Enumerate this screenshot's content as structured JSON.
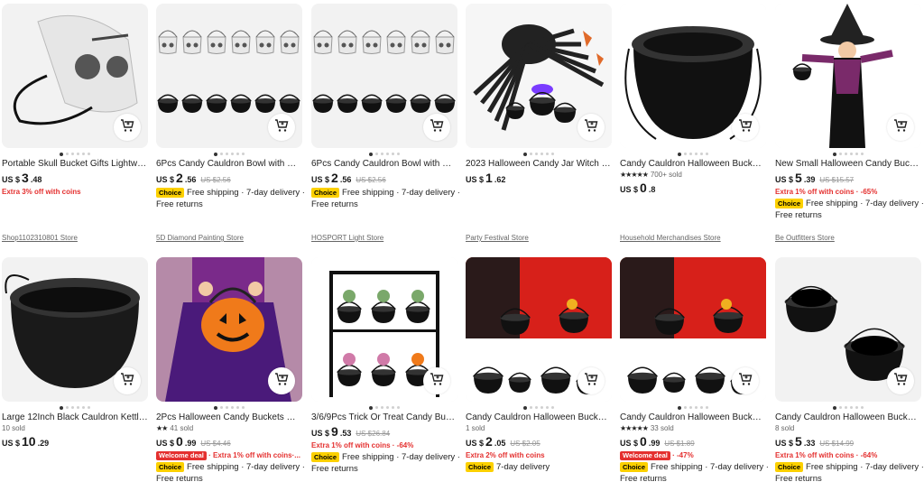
{
  "products": [
    {
      "title": "Portable Skull Bucket Gifts Lightwei...",
      "rating": "",
      "sold": "",
      "currency": "US $",
      "price_int": "3",
      "price_dec": ".48",
      "old_price": "",
      "promo": "Extra 3% off with coins",
      "deal_badge": "",
      "choice": "",
      "shipping": "",
      "returns": "",
      "store": "Shop1102310801 Store",
      "icon": "skull-bucket-image"
    },
    {
      "title": "6Pcs Candy Cauldron Bowl with Han...",
      "rating": "",
      "sold": "",
      "currency": "US $",
      "price_int": "2",
      "price_dec": ".56",
      "old_price": "US $2.56",
      "promo": "",
      "deal_badge": "",
      "choice": "Choice",
      "shipping": "Free shipping · 7-day delivery ·",
      "returns": "Free returns",
      "store": "5D Diamond Painting Store",
      "icon": "cauldron-set-image"
    },
    {
      "title": "6Pcs Candy Cauldron Bowl with Han...",
      "rating": "",
      "sold": "",
      "currency": "US $",
      "price_int": "2",
      "price_dec": ".56",
      "old_price": "US $2.56",
      "promo": "",
      "deal_badge": "",
      "choice": "Choice",
      "shipping": "Free shipping · 7-day delivery ·",
      "returns": "Free returns",
      "store": "HOSPORT Light Store",
      "icon": "cauldron-set-image"
    },
    {
      "title": "2023 Halloween Candy Jar Witch Fla...",
      "rating": "",
      "sold": "",
      "currency": "US $",
      "price_int": "1",
      "price_dec": ".62",
      "old_price": "",
      "promo": "",
      "deal_badge": "",
      "choice": "",
      "shipping": "",
      "returns": "",
      "store": "Party Festival Store",
      "icon": "spider-cauldron-image"
    },
    {
      "title": "Candy Cauldron Halloween Bucket ...",
      "rating": "★★★★★",
      "sold": "700+ sold",
      "currency": "US $",
      "price_int": "0",
      "price_dec": ".8",
      "old_price": "",
      "promo": "",
      "deal_badge": "",
      "choice": "",
      "shipping": "",
      "returns": "",
      "store": "Household Merchandises Store",
      "icon": "large-cauldron-image"
    },
    {
      "title": "New Small Halloween Candy Bucket...",
      "rating": "",
      "sold": "",
      "currency": "US $",
      "price_int": "5",
      "price_dec": ".39",
      "old_price": "US $15.57",
      "promo": "Extra 1% off with coins · -65%",
      "deal_badge": "",
      "choice": "Choice",
      "shipping": "Free shipping · 7-day delivery ·",
      "returns": "Free returns",
      "store": "Be Outfitters Store",
      "icon": "witch-costume-image"
    },
    {
      "title": "Large 12Inch Black Cauldron Kettle ...",
      "rating": "",
      "sold": "10 sold",
      "currency": "US $",
      "price_int": "10",
      "price_dec": ".29",
      "old_price": "",
      "promo": "",
      "deal_badge": "",
      "choice": "",
      "shipping": "",
      "returns": "",
      "store": "",
      "icon": "kettle-cauldron-image"
    },
    {
      "title": "2Pcs Halloween Candy Buckets Witc...",
      "rating": "★★",
      "sold": "41 sold",
      "currency": "US $",
      "price_int": "0",
      "price_dec": ".99",
      "old_price": "US $4.46",
      "promo": "· Extra 1% off with coins·...",
      "deal_badge": "Welcome deal",
      "choice": "Choice",
      "shipping": "Free shipping · 7-day delivery ·",
      "returns": "Free returns",
      "store": "",
      "icon": "pumpkin-bucket-image"
    },
    {
      "title": "3/6/9Pcs Trick Or Treat Candy Buck...",
      "rating": "",
      "sold": "",
      "currency": "US $",
      "price_int": "9",
      "price_dec": ".53",
      "old_price": "US $26.84",
      "promo": "Extra 1% off with coins · -64%",
      "deal_badge": "",
      "choice": "Choice",
      "shipping": "Free shipping · 7-day delivery ·",
      "returns": "Free returns",
      "store": "",
      "icon": "plant-cauldron-rack-image"
    },
    {
      "title": "Candy Cauldron Halloween Bucket ...",
      "rating": "",
      "sold": "1 sold",
      "currency": "US $",
      "price_int": "2",
      "price_dec": ".05",
      "old_price": "US $2.05",
      "promo": "Extra 2% off with coins",
      "deal_badge": "",
      "choice": "Choice",
      "shipping": "7-day delivery",
      "returns": "",
      "store": "",
      "icon": "kids-cauldron-image"
    },
    {
      "title": "Candy Cauldron Halloween Bucket ...",
      "rating": "★★★★★",
      "sold": "33 sold",
      "currency": "US $",
      "price_int": "0",
      "price_dec": ".99",
      "old_price": "US $1.89",
      "promo": "· -47%",
      "deal_badge": "Welcome deal",
      "choice": "Choice",
      "shipping": "Free shipping · 7-day delivery ·",
      "returns": "Free returns",
      "store": "",
      "icon": "kids-cauldron-image"
    },
    {
      "title": "Candy Cauldron Halloween Bucket ...",
      "rating": "",
      "sold": "8 sold",
      "currency": "US $",
      "price_int": "5",
      "price_dec": ".33",
      "old_price": "US $14.99",
      "promo": "Extra 1% off with coins · -64%",
      "deal_badge": "",
      "choice": "Choice",
      "shipping": "Free shipping · 7-day delivery ·",
      "returns": "Free returns",
      "store": "",
      "icon": "two-cauldrons-image"
    }
  ],
  "colors": {
    "accent": "#e4302f",
    "choice": "#fcd000",
    "image_bg": "#f2f2f2"
  }
}
